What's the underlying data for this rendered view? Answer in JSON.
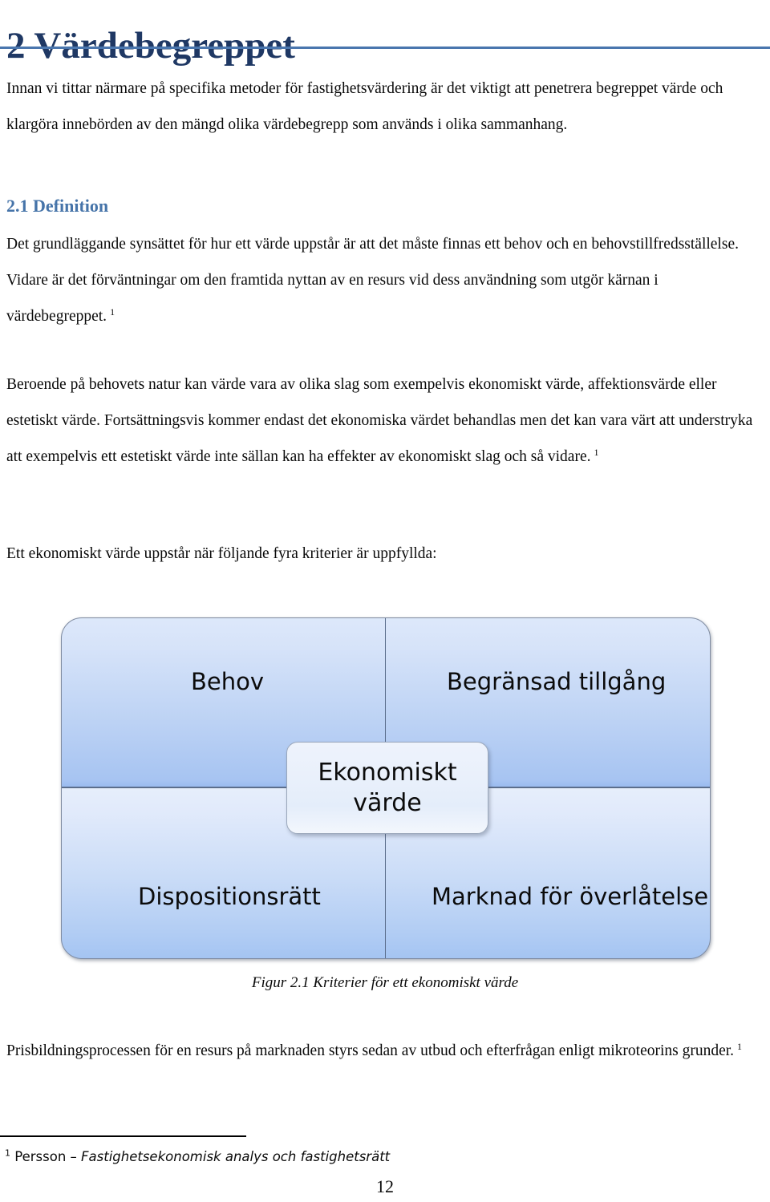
{
  "document": {
    "chapter_title": "2 Värdebegreppet",
    "page_number": "12"
  },
  "intro": {
    "paragraph": "Innan vi tittar närmare på specifika metoder för fastighetsvärdering är det viktigt att penetrera begreppet värde och klargöra innebörden av den mängd olika värdebegrepp som används i olika sammanhang."
  },
  "section": {
    "heading": "2.1 Definition",
    "paragraph_1": "Det grundläggande synsättet för hur ett värde uppstår är att det måste finnas ett behov och en behovstillfredsställelse. Vidare är det förväntningar om den framtida nyttan av en resurs vid dess användning som utgör kärnan i värdebegreppet.",
    "paragraph_1_footnote": "1",
    "paragraph_2": "Beroende på behovets natur kan värde vara av olika slag som exempelvis ekonomiskt värde, affektionsvärde eller estetiskt värde. Fortsättningsvis kommer endast det ekonomiska värdet behandlas men det kan vara värt att understryka att exempelvis ett estetiskt värde inte sällan kan ha effekter av ekonomiskt slag och så vidare.",
    "paragraph_2_footnote": "1",
    "lead_in": "Ett ekonomiskt värde uppstår när följande fyra kriterier är uppfyllda:",
    "paragraph_3": "Prisbildningsprocessen för en resurs på marknaden styrs sedan av utbud och efterfrågan enligt mikroteorins grunder.",
    "paragraph_3_footnote": "1"
  },
  "figure": {
    "caption": "Figur 2.1 Kriterier för ett ekonomiskt värde",
    "quadrants": {
      "top_left": "Behov",
      "top_right": "Begränsad tillgång",
      "bottom_left": "Dispositionsrätt",
      "bottom_right": "Marknad för överlåtelse"
    },
    "center": {
      "line_1": "Ekonomiskt",
      "line_2": "värde"
    }
  },
  "footnote": {
    "marker": "1",
    "author": " Persson – ",
    "work": "Fastighetsekonomisk analys och fastighetsrätt"
  },
  "colors": {
    "title": "#1F3864",
    "title_rule": "#4A76AE",
    "subheading": "#4674A9",
    "quadrant_light": "#dde8fa",
    "quadrant_mid": "#a7c4f2",
    "divider": "#5b6e8c"
  }
}
